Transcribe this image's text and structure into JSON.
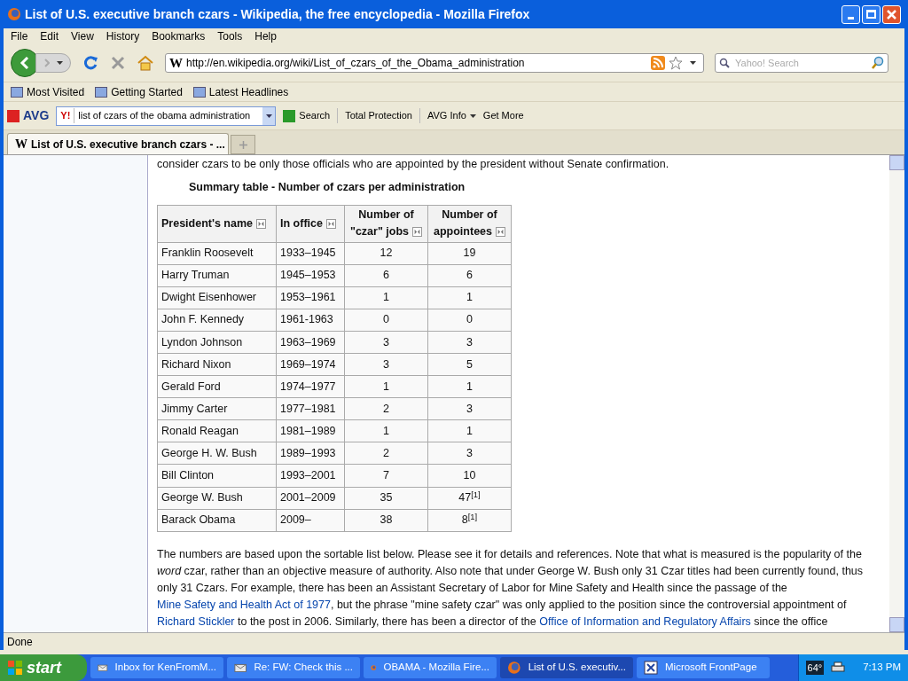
{
  "window": {
    "title": "List of U.S. executive branch czars - Wikipedia, the free encyclopedia - Mozilla Firefox"
  },
  "menu": [
    "File",
    "Edit",
    "View",
    "History",
    "Bookmarks",
    "Tools",
    "Help"
  ],
  "address": {
    "site_icon": "W",
    "value": "http://en.wikipedia.org/wiki/List_of_czars_of_the_Obama_administration"
  },
  "search": {
    "placeholder": "Yahoo! Search"
  },
  "bookmarks": [
    "Most Visited",
    "Getting Started",
    "Latest Headlines"
  ],
  "avg_toolbar": {
    "logo": "AVG",
    "engine": "Y!",
    "query": "list of czars of the obama administration",
    "search": "Search",
    "protection": "Total Protection",
    "info": "AVG Info",
    "more": "Get More"
  },
  "tabs": [
    {
      "icon": "W",
      "label": "List of U.S. executive branch czars - ...",
      "selected": true
    }
  ],
  "intro": "consider czars to be only those officials who are appointed by the president without Senate confirmation.",
  "table": {
    "caption": "Summary table - Number of czars per administration",
    "columns": [
      "President's name",
      "In office",
      "Number of \"czar\" jobs",
      "Number of appointees"
    ],
    "rows": [
      [
        "Franklin Roosevelt",
        "1933–1945",
        "12",
        "19"
      ],
      [
        "Harry Truman",
        "1945–1953",
        "6",
        "6"
      ],
      [
        "Dwight Eisenhower",
        "1953–1961",
        "1",
        "1"
      ],
      [
        "John F. Kennedy",
        "1961-1963",
        "0",
        "0"
      ],
      [
        "Lyndon Johnson",
        "1963–1969",
        "3",
        "3"
      ],
      [
        "Richard Nixon",
        "1969–1974",
        "3",
        "5"
      ],
      [
        "Gerald Ford",
        "1974–1977",
        "1",
        "1"
      ],
      [
        "Jimmy Carter",
        "1977–1981",
        "2",
        "3"
      ],
      [
        "Ronald Reagan",
        "1981–1989",
        "1",
        "1"
      ],
      [
        "George H. W. Bush",
        "1989–1993",
        "2",
        "3"
      ],
      [
        "Bill Clinton",
        "1993–2001",
        "7",
        "10"
      ],
      [
        "George W. Bush",
        "2001–2009",
        "35",
        "47$^{[1]}$"
      ],
      [
        "Barack Obama",
        "2009–",
        "38",
        "8$^{[1]}$"
      ]
    ]
  },
  "paragraph": [
    {
      "kind": "text",
      "text": "The numbers are based upon the sortable list below. Please see it for details and references. Note that what is measured is the popularity of the *word* czar, rather than an objective measure of authority. Also note that under George W. Bush only 31 Czar titles had been currently found, thus only 31 Czars. For example, there has been an Assistant Secretary of Labor for Mine Safety and Health since the passage of the "
    },
    {
      "kind": "link",
      "text": "Mine Safety and Health Act of 1977"
    },
    {
      "kind": "text",
      "text": ", but the phrase \"mine safety czar\" was only applied to the position since the controversial appointment of "
    },
    {
      "kind": "link",
      "text": "Richard Stickler"
    },
    {
      "kind": "text",
      "text": " to the post in 2006. Similarly, there has been a director of the "
    },
    {
      "kind": "link",
      "text": "Office of Information and Regulatory Affairs"
    },
    {
      "kind": "text",
      "text": " since the office"
    }
  ],
  "status_bar": "Done",
  "taskbar": {
    "start": "start",
    "items": [
      {
        "label": "Inbox for KenFromM...",
        "selected": false,
        "kind": "mail"
      },
      {
        "label": "Re: FW: Check this ...",
        "selected": false,
        "kind": "mail"
      },
      {
        "label": "OBAMA - Mozilla Fire...",
        "selected": false,
        "kind": "browser"
      },
      {
        "label": "List of U.S. executiv...",
        "selected": true,
        "kind": "browser"
      },
      {
        "label": "Microsoft FrontPage",
        "selected": false,
        "kind": "editor"
      }
    ],
    "temperature": "64°",
    "clock": "7:13 PM"
  }
}
